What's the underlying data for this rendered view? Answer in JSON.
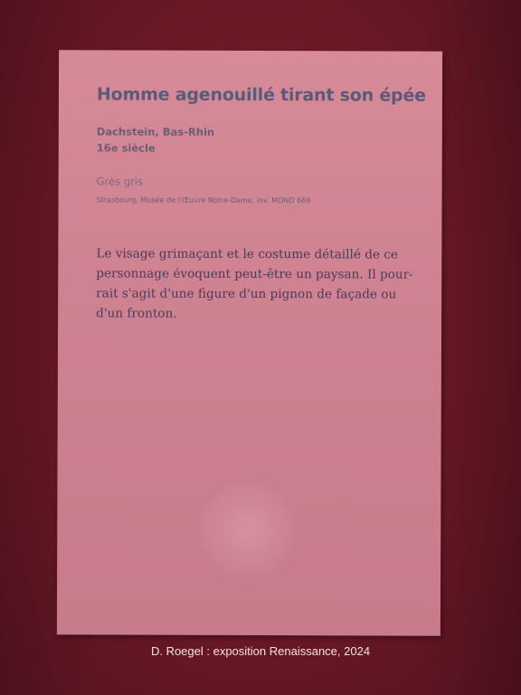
{
  "label_card": {
    "title": "Homme agenouillé tirant son épée",
    "origin": "Dachstein, Bas-Rhin",
    "date": "16e siècle",
    "material": "Grès gris",
    "inventory": "Strasbourg, Musée de l'Œuvre Notre-Dame, inv. MOND 669",
    "description_lines": [
      "Le visage grimaçant et le costume détaillé de ce",
      "personnage évoquent peut-être un paysan. Il pour-",
      "rait s'agit d'une figure d'un pignon de façade ou",
      "d'un fronton."
    ]
  },
  "caption": "D. Roegel : exposition Renaissance, 2024",
  "colors": {
    "wall": "#6b1825",
    "card": "#d28594",
    "title_text": "#5a5a7a",
    "body_text": "#4a3a58",
    "caption_text": "#f2e4e6"
  }
}
